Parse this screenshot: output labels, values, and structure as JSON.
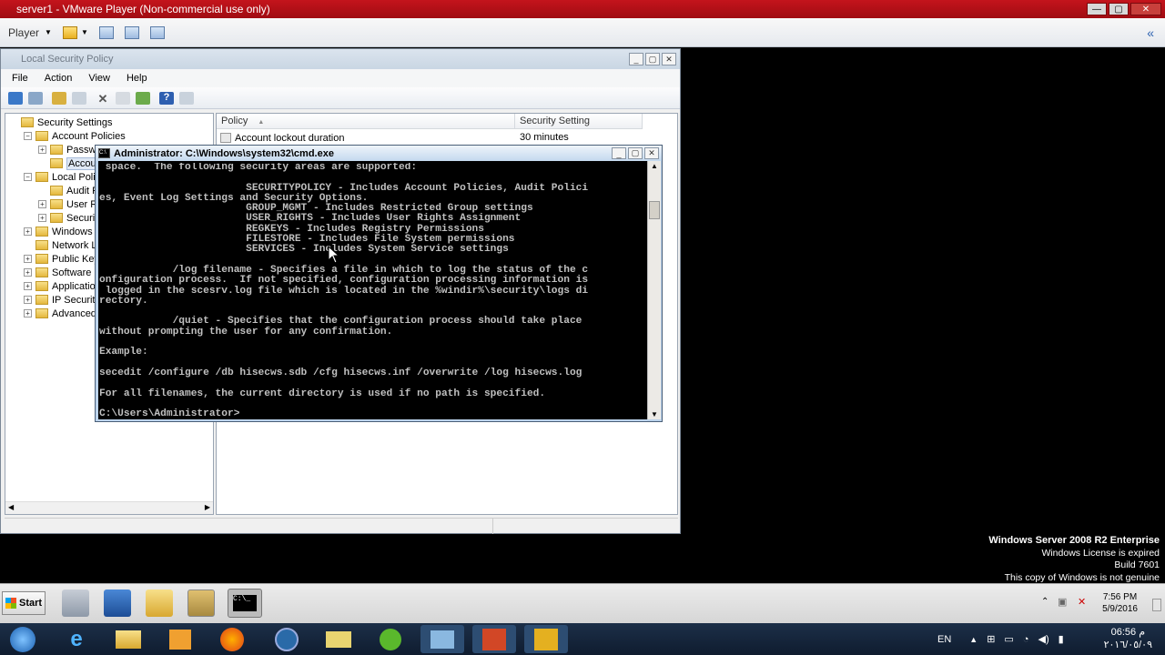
{
  "vmware": {
    "title": "server1 - VMware Player (Non-commercial use only)",
    "player_menu": "Player",
    "min": "—",
    "max": "▢",
    "close": "✕",
    "back_icon": "«"
  },
  "lsp": {
    "title": "Local Security Policy",
    "menu": [
      "File",
      "Action",
      "View",
      "Help"
    ],
    "tree": [
      {
        "label": "Security Settings",
        "indent": 0,
        "toggle": ""
      },
      {
        "label": "Account Policies",
        "indent": 1,
        "toggle": "−"
      },
      {
        "label": "Passwor",
        "indent": 2,
        "toggle": "+"
      },
      {
        "label": "Account",
        "indent": 2,
        "toggle": "",
        "selected": true
      },
      {
        "label": "Local Policies",
        "indent": 1,
        "toggle": "−"
      },
      {
        "label": "Audit Pol",
        "indent": 2,
        "toggle": ""
      },
      {
        "label": "User Righ",
        "indent": 2,
        "toggle": "+"
      },
      {
        "label": "Security",
        "indent": 2,
        "toggle": "+"
      },
      {
        "label": "Windows Fire",
        "indent": 1,
        "toggle": "+"
      },
      {
        "label": "Network List",
        "indent": 1,
        "toggle": ""
      },
      {
        "label": "Public Key Po",
        "indent": 1,
        "toggle": "+"
      },
      {
        "label": "Software Res",
        "indent": 1,
        "toggle": "+"
      },
      {
        "label": "Application C",
        "indent": 1,
        "toggle": "+"
      },
      {
        "label": "IP Security P",
        "indent": 1,
        "toggle": "+"
      },
      {
        "label": "Advanced Au",
        "indent": 1,
        "toggle": "+"
      }
    ],
    "columns": {
      "policy": "Policy",
      "setting": "Security Setting"
    },
    "rows": [
      {
        "policy": "Account lockout duration",
        "setting": "30 minutes"
      }
    ]
  },
  "cmd": {
    "title": "Administrator: C:\\Windows\\system32\\cmd.exe",
    "lines": [
      " space.  The following security areas are supported:",
      "",
      "                        SECURITYPOLICY - Includes Account Policies, Audit Polici",
      "es, Event Log Settings and Security Options.",
      "                        GROUP_MGMT - Includes Restricted Group settings",
      "                        USER_RIGHTS - Includes User Rights Assignment",
      "                        REGKEYS - Includes Registry Permissions",
      "                        FILESTORE - Includes File System permissions",
      "                        SERVICES - Includes System Service settings",
      "",
      "            /log filename - Specifies a file in which to log the status of the c",
      "onfiguration process.  If not specified, configuration processing information is",
      " logged in the scesrv.log file which is located in the %windir%\\security\\logs di",
      "rectory.",
      "",
      "            /quiet - Specifies that the configuration process should take place",
      "without prompting the user for any confirmation.",
      "",
      "Example:",
      "",
      "secedit /configure /db hisecws.sdb /cfg hisecws.inf /overwrite /log hisecws.log",
      "",
      "For all filenames, the current directory is used if no path is specified.",
      "",
      "C:\\Users\\Administrator>"
    ]
  },
  "watermark": {
    "edition": "Windows Server 2008 R2 Enterprise",
    "license": "Windows License is expired",
    "build": "Build 7601",
    "genuine": "This copy of Windows is not genuine"
  },
  "guest_taskbar": {
    "start": "Start",
    "time": "7:56 PM",
    "date": "5/9/2016"
  },
  "host_taskbar": {
    "lang": "EN",
    "time": "06:56 م",
    "date": "٢٠١٦/٠٥/٠٩"
  }
}
